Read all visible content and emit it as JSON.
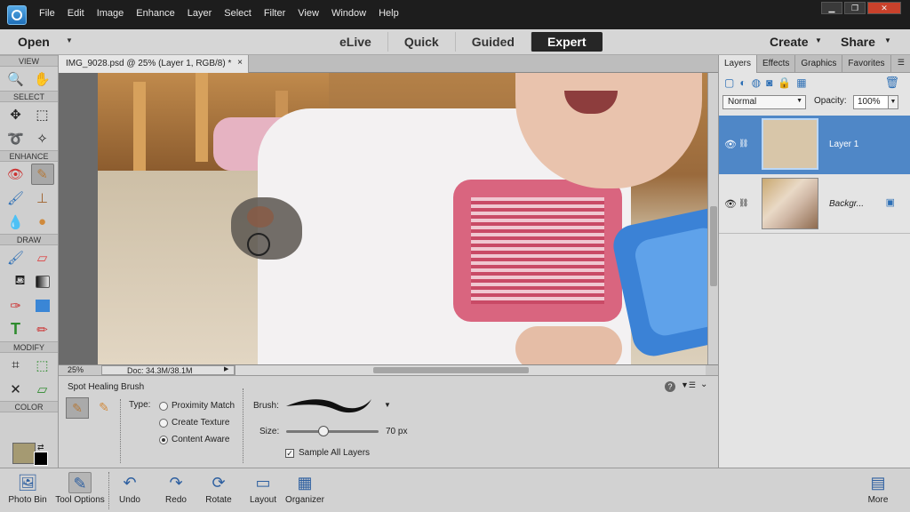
{
  "menu": [
    "File",
    "Edit",
    "Image",
    "Enhance",
    "Layer",
    "Select",
    "Filter",
    "View",
    "Window",
    "Help"
  ],
  "modebar": {
    "open": "Open",
    "tabs": [
      {
        "label": "eLive",
        "active": false
      },
      {
        "label": "Quick",
        "active": false
      },
      {
        "label": "Guided",
        "active": false
      },
      {
        "label": "Expert",
        "active": true
      }
    ],
    "create": "Create",
    "share": "Share"
  },
  "toolbox": {
    "view": "VIEW",
    "select": "SELECT",
    "enhance": "ENHANCE",
    "draw": "DRAW",
    "modify": "MODIFY",
    "color": "COLOR",
    "foreground": "#a59a72",
    "background": "#000000"
  },
  "document": {
    "tab_title": "IMG_9028.psd @ 25% (Layer 1, RGB/8) *",
    "close": "×",
    "zoom": "25%",
    "doc_size": "Doc: 34.3M/38.1M"
  },
  "tool_options": {
    "title": "Spot Healing Brush",
    "type_label": "Type:",
    "types": [
      {
        "label": "Proximity Match",
        "selected": false
      },
      {
        "label": "Create Texture",
        "selected": false
      },
      {
        "label": "Content Aware",
        "selected": true
      }
    ],
    "brush_label": "Brush:",
    "size_label": "Size:",
    "size_value": "70 px",
    "size_fraction": 0.4,
    "sample_all_layers": "Sample All Layers",
    "sample_checked": true
  },
  "panel": {
    "tabs": [
      {
        "label": "Layers",
        "active": true
      },
      {
        "label": "Effects",
        "active": false
      },
      {
        "label": "Graphics",
        "active": false
      },
      {
        "label": "Favorites",
        "active": false
      }
    ],
    "blend_mode": "Normal",
    "opacity_label": "Opacity:",
    "opacity": "100%",
    "layers": [
      {
        "name": "Layer 1",
        "selected": true
      },
      {
        "name": "Backgr...",
        "selected": false
      }
    ]
  },
  "bottombar": [
    {
      "label": "Photo Bin",
      "icon": "photo-bin-icon",
      "active": false
    },
    {
      "label": "Tool Options",
      "icon": "tool-options-icon",
      "active": true
    },
    {
      "label": "Undo",
      "icon": "undo-icon",
      "active": false
    },
    {
      "label": "Redo",
      "icon": "redo-icon",
      "active": false
    },
    {
      "label": "Rotate",
      "icon": "rotate-icon",
      "active": false
    },
    {
      "label": "Layout",
      "icon": "layout-icon",
      "active": false
    },
    {
      "label": "Organizer",
      "icon": "organizer-icon",
      "active": false
    },
    {
      "label": "More",
      "icon": "more-icon",
      "active": false
    }
  ]
}
